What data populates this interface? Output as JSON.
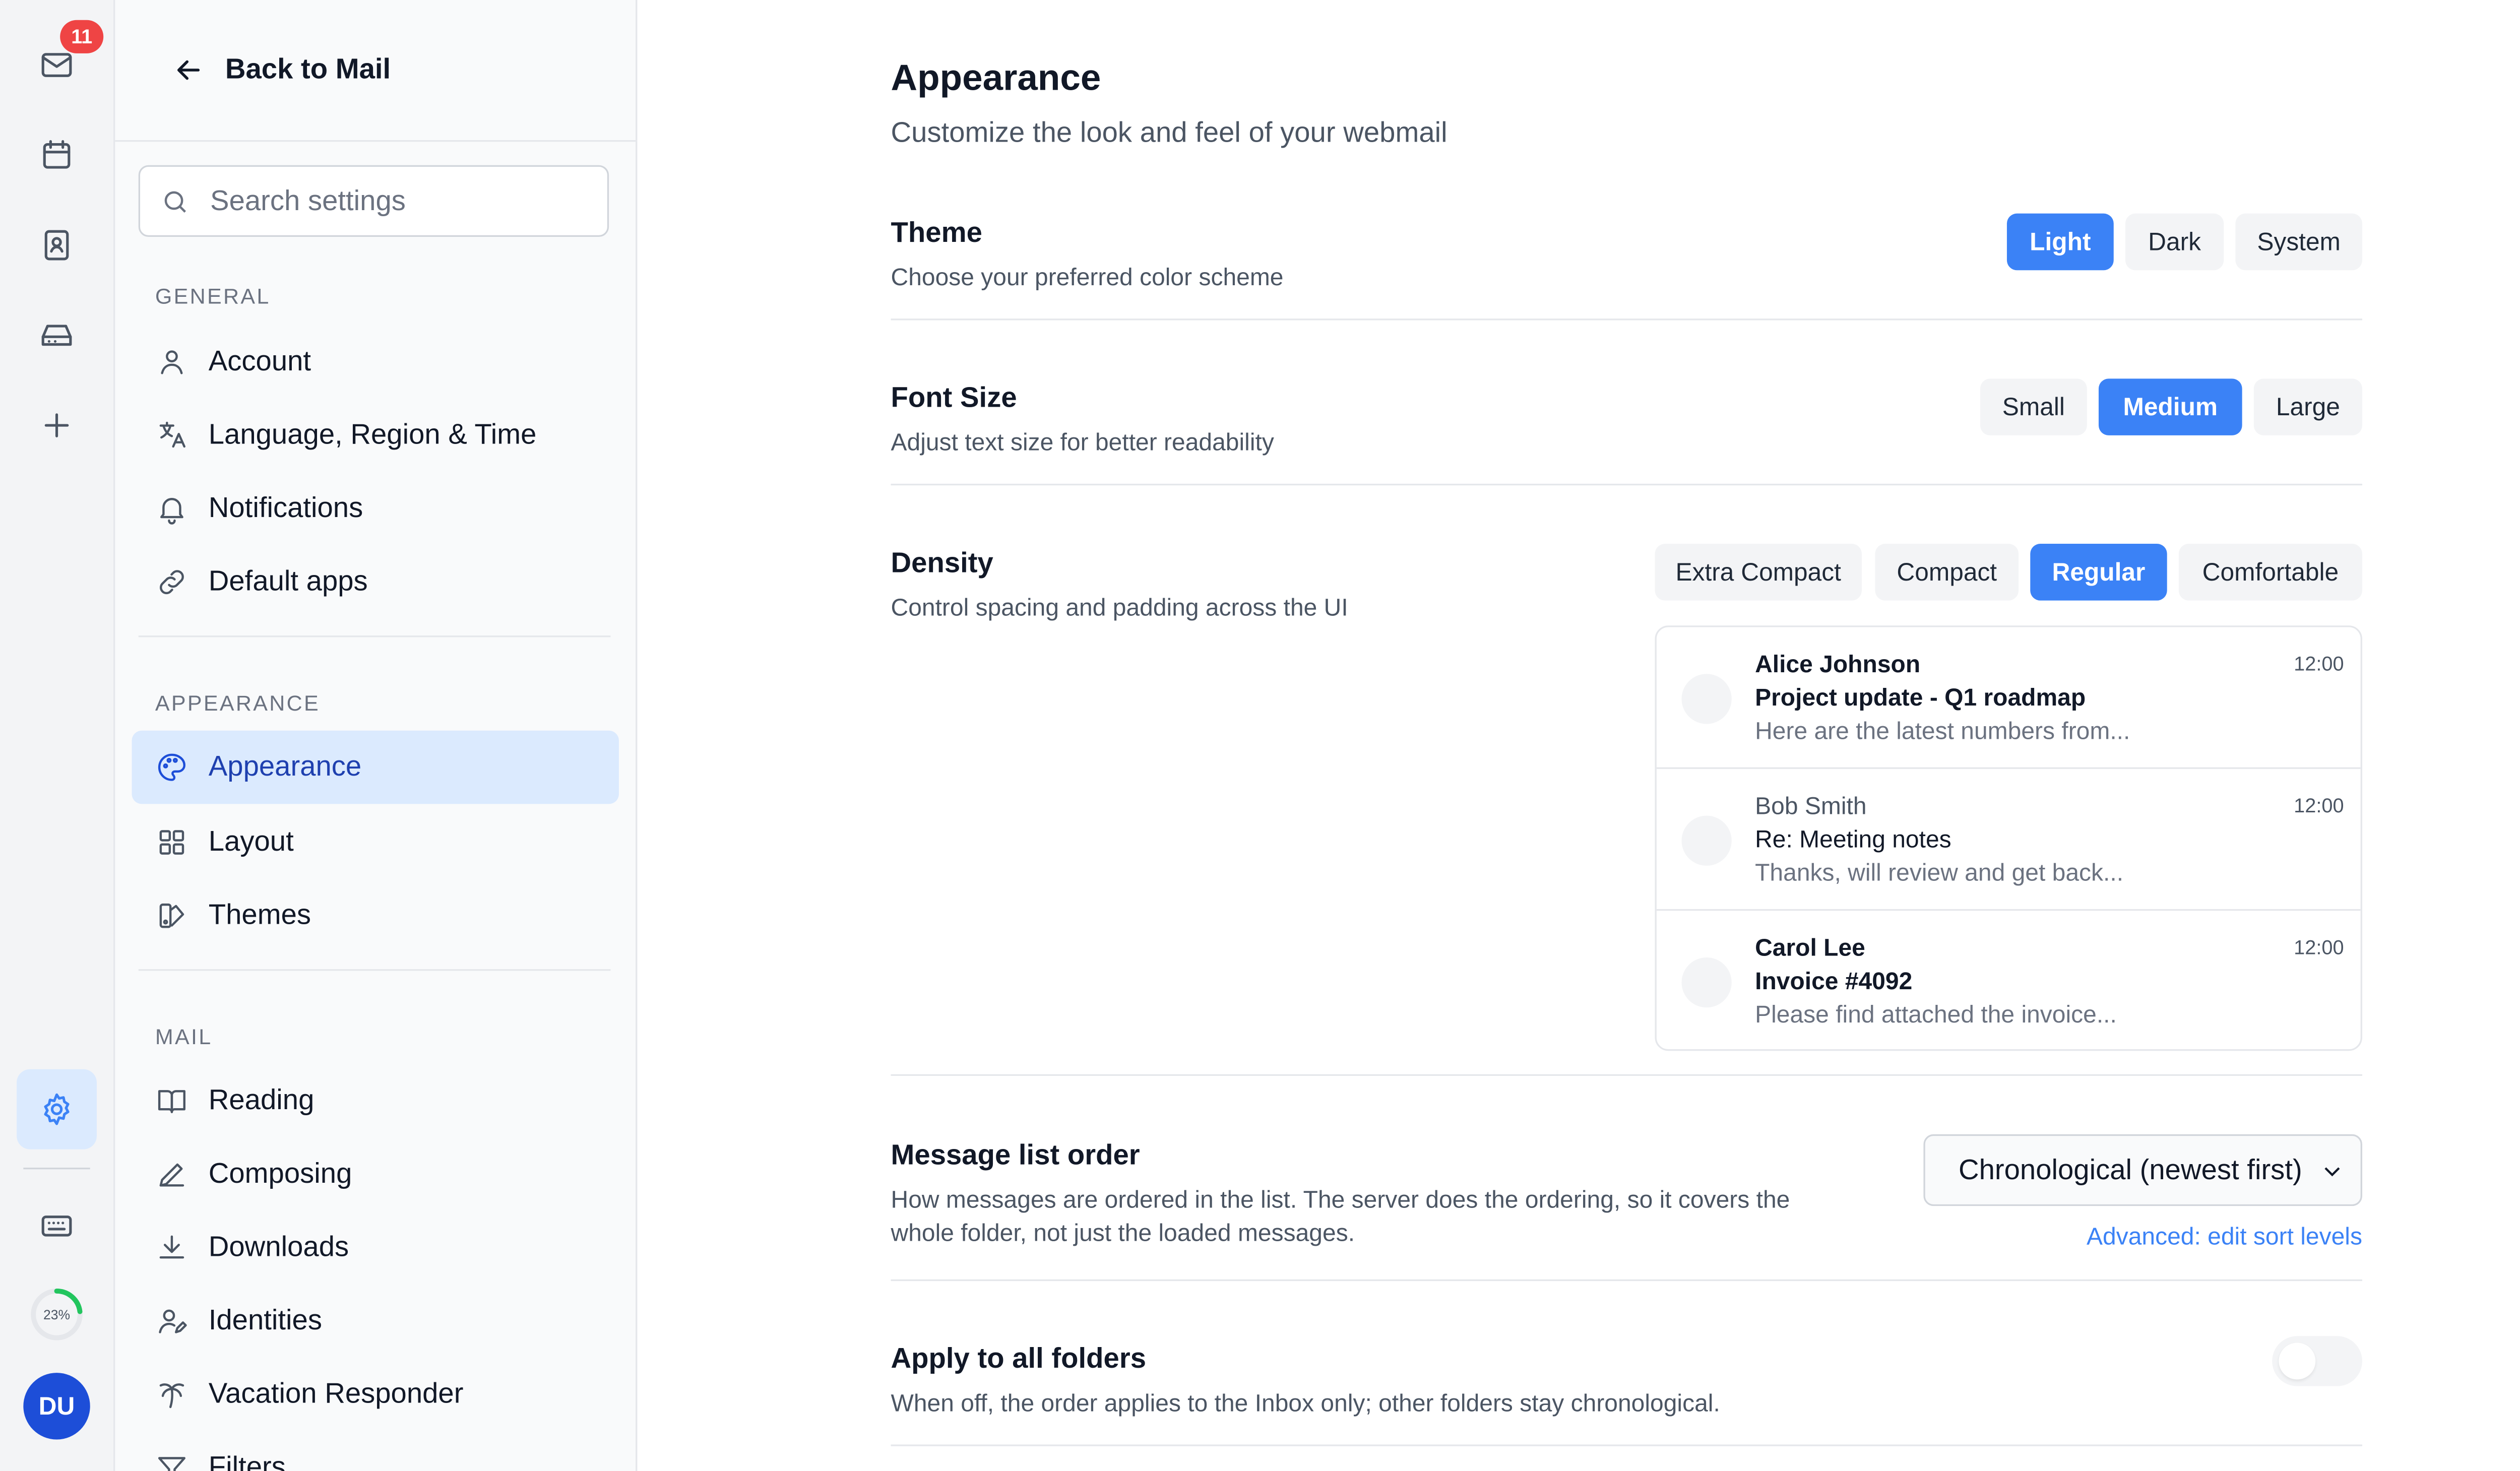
{
  "rail": {
    "mail_badge": "11",
    "storage_percent": "23%",
    "storage_fraction": 0.23,
    "avatar_initials": "DU",
    "icons": [
      "mail-icon",
      "calendar-icon",
      "contacts-icon",
      "drive-icon",
      "plus-icon",
      "settings-icon",
      "keyboard-icon"
    ]
  },
  "sidebar": {
    "back_label": "Back to Mail",
    "search_placeholder": "Search settings",
    "general": {
      "heading": "GENERAL",
      "items": [
        {
          "label": "Account",
          "icon": "user-icon"
        },
        {
          "label": "Language, Region & Time",
          "icon": "translate-icon"
        },
        {
          "label": "Notifications",
          "icon": "bell-icon"
        },
        {
          "label": "Default apps",
          "icon": "link-icon"
        }
      ]
    },
    "appearance": {
      "heading": "APPEARANCE",
      "items": [
        {
          "label": "Appearance",
          "icon": "palette-icon",
          "active": true
        },
        {
          "label": "Layout",
          "icon": "grid-icon"
        },
        {
          "label": "Themes",
          "icon": "swatch-icon"
        }
      ]
    },
    "mail": {
      "heading": "MAIL",
      "items": [
        {
          "label": "Reading",
          "icon": "book-icon"
        },
        {
          "label": "Composing",
          "icon": "pencil-icon"
        },
        {
          "label": "Downloads",
          "icon": "download-icon"
        },
        {
          "label": "Identities",
          "icon": "identity-icon"
        },
        {
          "label": "Vacation Responder",
          "icon": "palm-tree-icon"
        },
        {
          "label": "Filters",
          "icon": "filter-icon"
        }
      ]
    }
  },
  "main": {
    "title": "Appearance",
    "subtitle": "Customize the look and feel of your webmail",
    "theme": {
      "title": "Theme",
      "desc": "Choose your preferred color scheme",
      "options": [
        "Light",
        "Dark",
        "System"
      ],
      "selected": "Light"
    },
    "font_size": {
      "title": "Font Size",
      "desc": "Adjust text size for better readability",
      "options": [
        "Small",
        "Medium",
        "Large"
      ],
      "selected": "Medium"
    },
    "density": {
      "title": "Density",
      "desc": "Control spacing and padding across the UI",
      "options": [
        "Extra Compact",
        "Compact",
        "Regular",
        "Comfortable"
      ],
      "selected": "Regular",
      "preview": [
        {
          "from": "Alice Johnson",
          "subject": "Project update - Q1 roadmap",
          "snippet": "Here are the latest numbers from...",
          "time": "12:00",
          "unread": true
        },
        {
          "from": "Bob Smith",
          "subject": "Re: Meeting notes",
          "snippet": "Thanks, will review and get back...",
          "time": "12:00",
          "unread": false
        },
        {
          "from": "Carol Lee",
          "subject": "Invoice #4092",
          "snippet": "Please find attached the invoice...",
          "time": "12:00",
          "unread": true
        }
      ]
    },
    "order": {
      "title": "Message list order",
      "desc": "How messages are ordered in the list. The server does the ordering, so it covers the whole folder, not just the loaded messages.",
      "selected": "Chronological (newest first)",
      "advanced_link": "Advanced: edit sort levels"
    },
    "apply_all": {
      "title": "Apply to all folders",
      "desc": "When off, the order applies to the Inbox only; other folders stay chronological.",
      "enabled": false
    }
  },
  "colors": {
    "accent": "#3b82f6",
    "active_nav_bg": "#dbeafe",
    "badge": "#ef4444",
    "avatar": "#1d4ed8",
    "storage_ring": "#22c55e"
  }
}
